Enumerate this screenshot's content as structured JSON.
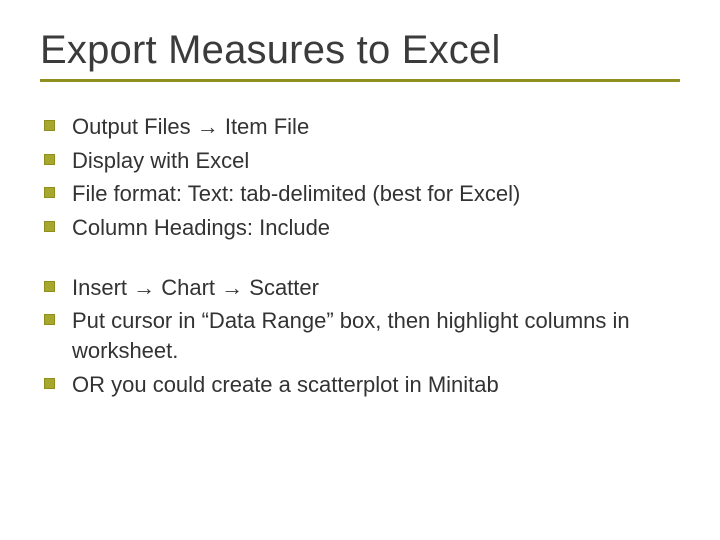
{
  "title": "Export Measures to Excel",
  "group1": {
    "items": [
      "Output Files → Item File",
      "Display with Excel",
      "File format: Text: tab-delimited (best for Excel)",
      "Column Headings: Include"
    ]
  },
  "group2": {
    "items": [
      "Insert → Chart → Scatter",
      "Put cursor in “Data Range” box, then highlight columns in worksheet.",
      "OR you could create a scatterplot in Minitab"
    ]
  }
}
